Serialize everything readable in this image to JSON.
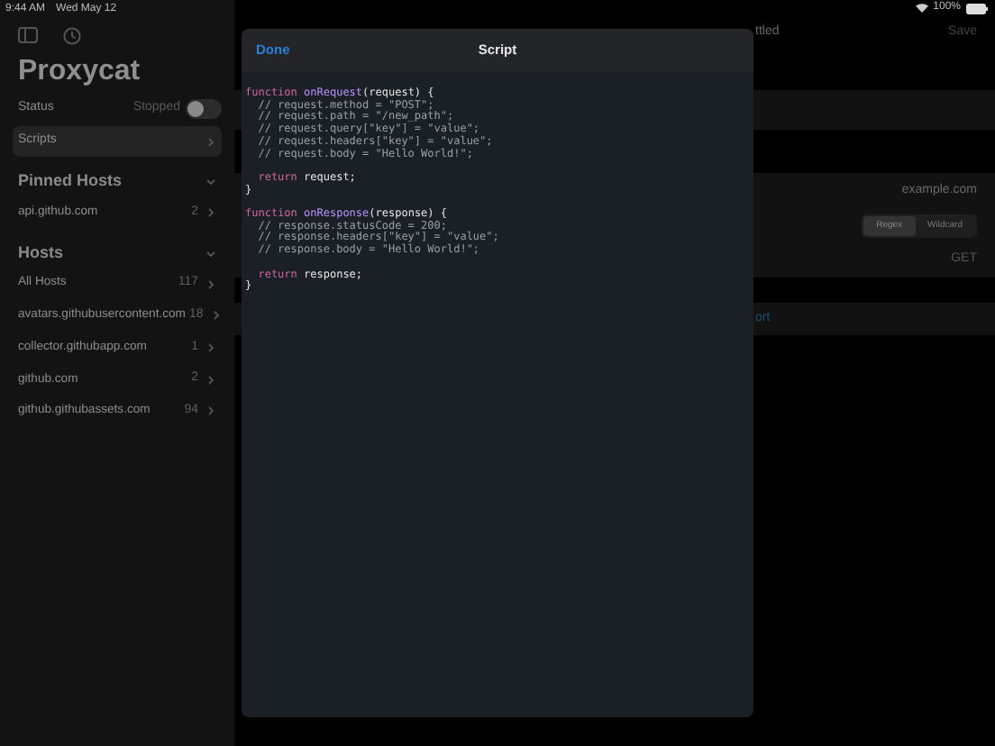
{
  "status_bar": {
    "time": "9:44 AM",
    "date": "Wed May 12",
    "battery": "100%"
  },
  "sidebar": {
    "title": "Proxycat",
    "status": {
      "label": "Status",
      "value": "Stopped",
      "on": false
    },
    "scripts": {
      "label": "Scripts",
      "selected": true
    },
    "sections": [
      {
        "title": "Pinned Hosts",
        "expanded": true,
        "items": [
          {
            "host": "api.github.com",
            "count": "2"
          }
        ]
      },
      {
        "title": "Hosts",
        "expanded": true,
        "items": [
          {
            "host": "All Hosts",
            "count": "117"
          },
          {
            "host": "avatars.githubusercontent.com",
            "count": "18"
          },
          {
            "host": "collector.githubapp.com",
            "count": "1"
          },
          {
            "host": "github.com",
            "count": "2"
          },
          {
            "host": "github.githubassets.com",
            "count": "94"
          }
        ]
      }
    ]
  },
  "detail": {
    "title": "ttled",
    "save": "Save",
    "host": "example.com",
    "match_modes": [
      {
        "label": "Regex",
        "selected": true
      },
      {
        "label": "Wildcard",
        "selected": false
      }
    ],
    "method": "GET",
    "link": "ort"
  },
  "sheet": {
    "done": "Done",
    "title": "Script",
    "code": [
      {
        "kind": "code",
        "segments": [
          {
            "kind": "keyword",
            "text": "function"
          },
          {
            "kind": "name",
            "text": " onRequest"
          },
          {
            "kind": "plain",
            "text": "(request) {"
          }
        ]
      },
      {
        "kind": "code",
        "segments": [
          {
            "kind": "comment",
            "text": "  // request.method = \"POST\";"
          }
        ]
      },
      {
        "kind": "code",
        "segments": [
          {
            "kind": "comment",
            "text": "  // request.path = \"/new_path\";"
          }
        ]
      },
      {
        "kind": "code",
        "segments": [
          {
            "kind": "comment",
            "text": "  // request.query[\"key\"] = \"value\";"
          }
        ]
      },
      {
        "kind": "code",
        "segments": [
          {
            "kind": "comment",
            "text": "  // request.headers[\"key\"] = \"value\";"
          }
        ]
      },
      {
        "kind": "code",
        "segments": [
          {
            "kind": "comment",
            "text": "  // request.body = \"Hello World!\";"
          }
        ]
      },
      {
        "kind": "blank"
      },
      {
        "kind": "code",
        "segments": [
          {
            "kind": "keyword",
            "text": "  return"
          },
          {
            "kind": "plain",
            "text": " request;"
          }
        ]
      },
      {
        "kind": "code",
        "segments": [
          {
            "kind": "plain",
            "text": "}"
          }
        ]
      },
      {
        "kind": "blank"
      },
      {
        "kind": "code",
        "segments": [
          {
            "kind": "keyword",
            "text": "function"
          },
          {
            "kind": "name",
            "text": " onResponse"
          },
          {
            "kind": "plain",
            "text": "(response) {"
          }
        ]
      },
      {
        "kind": "code",
        "segments": [
          {
            "kind": "comment",
            "text": "  // response.statusCode = 200;"
          }
        ]
      },
      {
        "kind": "code",
        "segments": [
          {
            "kind": "comment",
            "text": "  // response.headers[\"key\"] = \"value\";"
          }
        ]
      },
      {
        "kind": "code",
        "segments": [
          {
            "kind": "comment",
            "text": "  // response.body = \"Hello World!\";"
          }
        ]
      },
      {
        "kind": "blank"
      },
      {
        "kind": "code",
        "segments": [
          {
            "kind": "keyword",
            "text": "  return"
          },
          {
            "kind": "plain",
            "text": " response;"
          }
        ]
      },
      {
        "kind": "code",
        "segments": [
          {
            "kind": "plain",
            "text": "}"
          }
        ]
      }
    ]
  }
}
